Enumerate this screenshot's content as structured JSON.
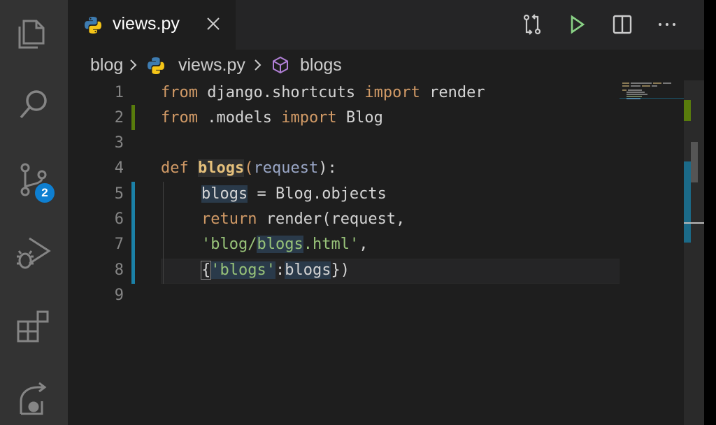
{
  "tab": {
    "title": "views.py"
  },
  "scm": {
    "badge_count": "2"
  },
  "breadcrumb": {
    "folder": "blog",
    "file": "views.py",
    "symbol": "blogs"
  },
  "line_numbers": [
    "1",
    "2",
    "3",
    "4",
    "5",
    "6",
    "7",
    "8",
    "9"
  ],
  "code": {
    "l1": {
      "from": "from",
      "module": " django.shortcuts ",
      "import": "import",
      "name": " render"
    },
    "l2": {
      "from": "from",
      "module": " .models ",
      "import": "import",
      "name": " Blog"
    },
    "l4": {
      "def": "def",
      "sp": " ",
      "fn": "blogs",
      "open": "(",
      "param": "request",
      "close": "):"
    },
    "l5": {
      "var": "blogs",
      "rest": " = Blog.objects"
    },
    "l6": {
      "ret": "return",
      "rest": " render(request,"
    },
    "l7": {
      "q1": "'blog/",
      "hl": "blogs",
      "q2": ".html'",
      "comma": ","
    },
    "l8": {
      "brace_open": "{",
      "key": "'blogs'",
      "colon": ":",
      "val": "blogs",
      "brace_close": "})"
    }
  },
  "colors": {
    "accent_blue": "#0e7fd1",
    "added_line": "#587c0c",
    "modified_line": "#1b81a8",
    "run_green": "#89d185"
  },
  "icons": {
    "activity": [
      "explorer-icon",
      "search-icon",
      "source-control-icon",
      "run-debug-icon",
      "extensions-icon",
      "remote-explorer-icon"
    ],
    "toolbar": [
      "compare-changes-icon",
      "run-icon",
      "split-editor-icon",
      "more-actions-icon"
    ]
  }
}
